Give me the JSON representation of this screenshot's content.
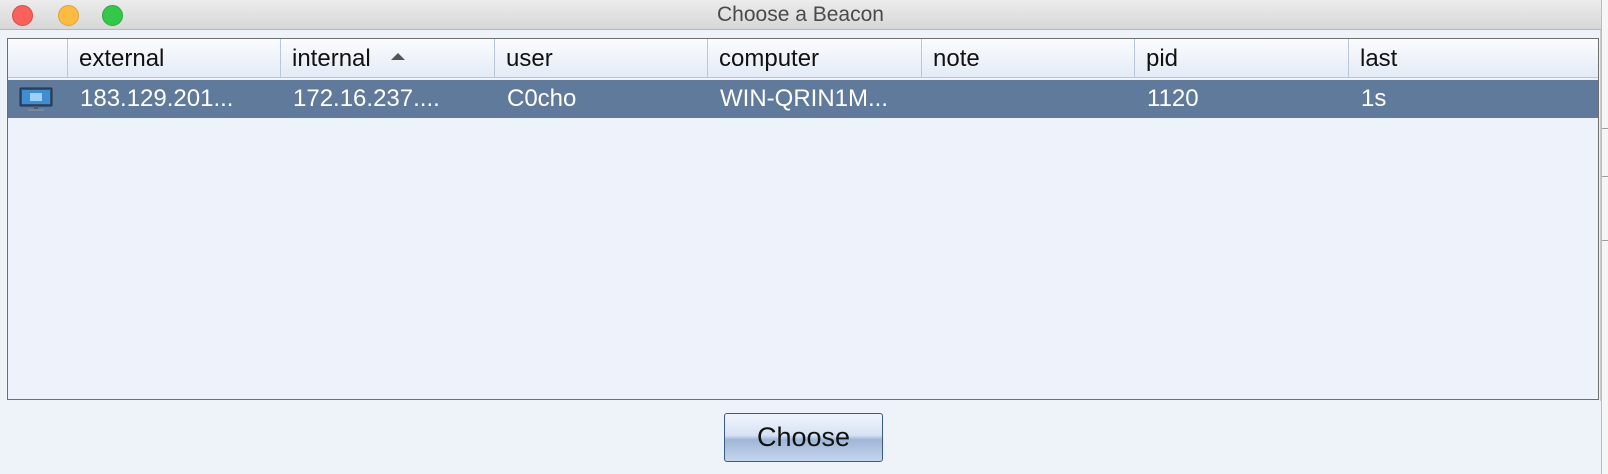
{
  "window": {
    "title": "Choose a Beacon"
  },
  "table": {
    "columns": [
      {
        "label": ""
      },
      {
        "label": "external"
      },
      {
        "label": "internal"
      },
      {
        "label": "user"
      },
      {
        "label": "computer"
      },
      {
        "label": "note"
      },
      {
        "label": "pid"
      },
      {
        "label": "last"
      }
    ],
    "sort_column": "internal",
    "sort_direction": "ascending",
    "rows": [
      {
        "icon": "beacon-monitor-icon",
        "external": "183.129.201...",
        "internal": "172.16.237....",
        "user": "C0cho",
        "computer": "WIN-QRIN1M...",
        "note": "",
        "pid": "1120",
        "last": "1s",
        "selected": true
      }
    ]
  },
  "footer": {
    "choose_label": "Choose"
  },
  "colors": {
    "selection": "#5f7a9b",
    "close": "#fc605b",
    "minimize": "#fdbc40",
    "zoom": "#34c84a"
  }
}
